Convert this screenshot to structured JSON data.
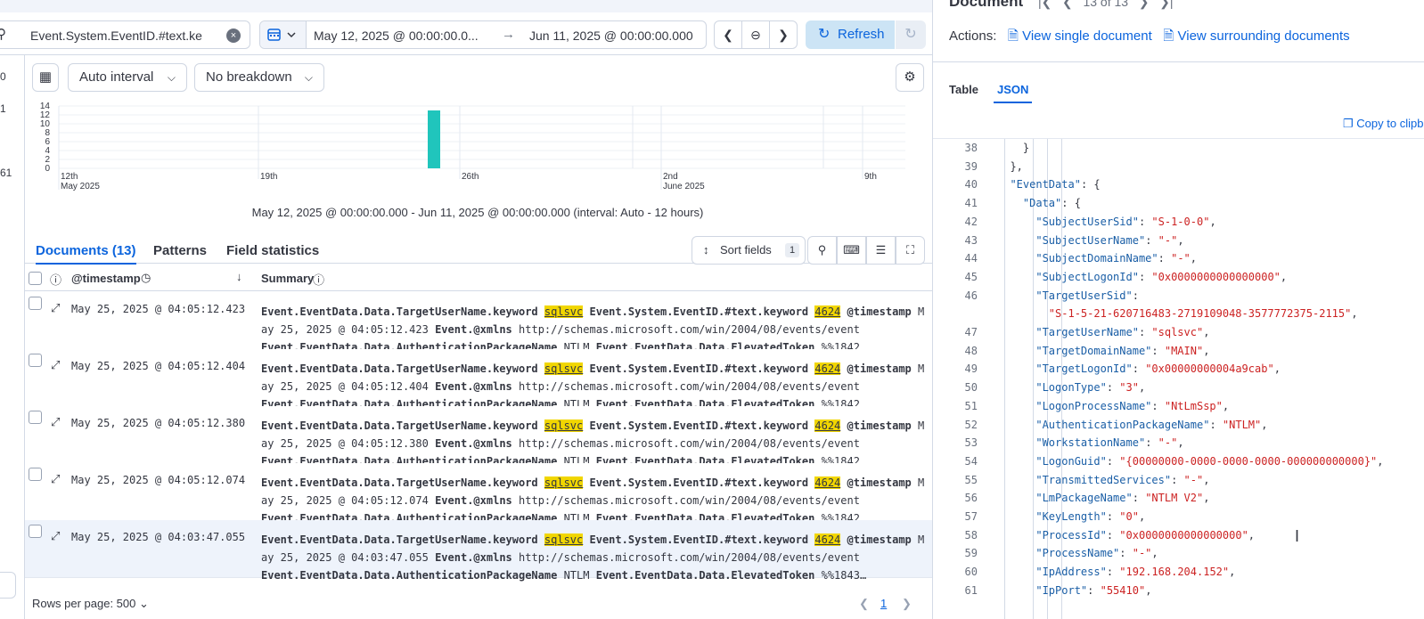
{
  "query": {
    "value": "Event.System.EventID.#text.ke"
  },
  "dates": {
    "start": "May 12, 2025 @ 00:00:00.0...",
    "end": "Jun 11, 2025 @ 00:00:00.000"
  },
  "refresh_label": "Refresh",
  "left_counts": [
    "0",
    "1",
    "61"
  ],
  "toolbar": {
    "interval": "Auto interval",
    "breakdown": "No breakdown"
  },
  "histogram": {
    "y_ticks": [
      "14",
      "12",
      "10",
      "8",
      "6",
      "4",
      "2",
      "0"
    ],
    "x_labels": [
      {
        "day": "12th",
        "month": "May 2025"
      },
      {
        "day": "19th",
        "month": ""
      },
      {
        "day": "26th",
        "month": ""
      },
      {
        "day": "2nd",
        "month": "June 2025"
      },
      {
        "day": "9th",
        "month": ""
      }
    ],
    "bar_value": 13,
    "bar_color": "#20c5bc",
    "caption": "May 12, 2025 @ 00:00:00.000 - Jun 11, 2025 @ 00:00:00.000 (interval: Auto - 12 hours)"
  },
  "tabs": {
    "documents": "Documents (13)",
    "patterns": "Patterns",
    "field_stats": "Field statistics"
  },
  "sort": {
    "label": "Sort fields",
    "count": "1"
  },
  "grid": {
    "col_timestamp": "@timestamp",
    "col_summary": "Summary"
  },
  "rows": [
    {
      "ts": "May 25, 2025 @ 04:05:12.423",
      "ts2": "ay 25, 2025 @ 04:05:12.423",
      "tok": "%%1842…"
    },
    {
      "ts": "May 25, 2025 @ 04:05:12.404",
      "ts2": "ay 25, 2025 @ 04:05:12.404",
      "tok": "%%1842…"
    },
    {
      "ts": "May 25, 2025 @ 04:05:12.380",
      "ts2": "ay 25, 2025 @ 04:05:12.380",
      "tok": "%%1842…"
    },
    {
      "ts": "May 25, 2025 @ 04:05:12.074",
      "ts2": "ay 25, 2025 @ 04:05:12.074",
      "tok": "%%1842…"
    },
    {
      "ts": "May 25, 2025 @ 04:03:47.055",
      "ts2": "ay 25, 2025 @ 04:03:47.055",
      "tok": "%%1843…"
    }
  ],
  "summary_parts": {
    "f1": "Event.EventData.Data.TargetUserName.keyword",
    "v1": "sqlsvc",
    "f2": "Event.System.EventID.#text.keyword",
    "v2": "4624",
    "f3": "@timestamp",
    "m": "M",
    "f4": "Event.@xmlns",
    "v4": "http://schemas.microsoft.com/win/2004/08/events/event",
    "f5": "Event.EventData.Data.AuthenticationPackageName",
    "v5": "NTLM",
    "f6": "Event.EventData.Data.ElevatedToken"
  },
  "footer": {
    "rows_per_page": "Rows per page: 500",
    "page": "1"
  },
  "panel": {
    "title": "Document",
    "pager": "13 of 13",
    "actions_label": "Actions:",
    "view_single": "View single document",
    "view_surrounding": "View surrounding documents",
    "tab_table": "Table",
    "tab_json": "JSON",
    "copy": "Copy to clipb"
  },
  "code_lines": [
    {
      "n": "38",
      "t": "    }"
    },
    {
      "n": "39",
      "t": "  },"
    },
    {
      "n": "40",
      "t": "  \"EventData\": {"
    },
    {
      "n": "41",
      "t": "    \"Data\": {"
    },
    {
      "n": "42",
      "t": "      \"SubjectUserSid\": \"S-1-0-0\","
    },
    {
      "n": "43",
      "t": "      \"SubjectUserName\": \"-\","
    },
    {
      "n": "44",
      "t": "      \"SubjectDomainName\": \"-\","
    },
    {
      "n": "45",
      "t": "      \"SubjectLogonId\": \"0x0000000000000000\","
    },
    {
      "n": "46",
      "t": "      \"TargetUserSid\":"
    },
    {
      "n": "",
      "t": "        \"S-1-5-21-620716483-2719109048-3577772375-2115\","
    },
    {
      "n": "47",
      "t": "      \"TargetUserName\": \"sqlsvc\","
    },
    {
      "n": "48",
      "t": "      \"TargetDomainName\": \"MAIN\","
    },
    {
      "n": "49",
      "t": "      \"TargetLogonId\": \"0x00000000004a9cab\","
    },
    {
      "n": "50",
      "t": "      \"LogonType\": \"3\","
    },
    {
      "n": "51",
      "t": "      \"LogonProcessName\": \"NtLmSsp\","
    },
    {
      "n": "52",
      "t": "      \"AuthenticationPackageName\": \"NTLM\","
    },
    {
      "n": "53",
      "t": "      \"WorkstationName\": \"-\","
    },
    {
      "n": "54",
      "t": "      \"LogonGuid\": \"{00000000-0000-0000-0000-000000000000}\","
    },
    {
      "n": "55",
      "t": "      \"TransmittedServices\": \"-\","
    },
    {
      "n": "56",
      "t": "      \"LmPackageName\": \"NTLM V2\","
    },
    {
      "n": "57",
      "t": "      \"KeyLength\": \"0\","
    },
    {
      "n": "58",
      "t": "      \"ProcessId\": \"0x0000000000000000\","
    },
    {
      "n": "59",
      "t": "      \"ProcessName\": \"-\","
    },
    {
      "n": "60",
      "t": "      \"IpAddress\": \"192.168.204.152\","
    },
    {
      "n": "61",
      "t": "      \"IpPort\": \"55410\","
    }
  ]
}
